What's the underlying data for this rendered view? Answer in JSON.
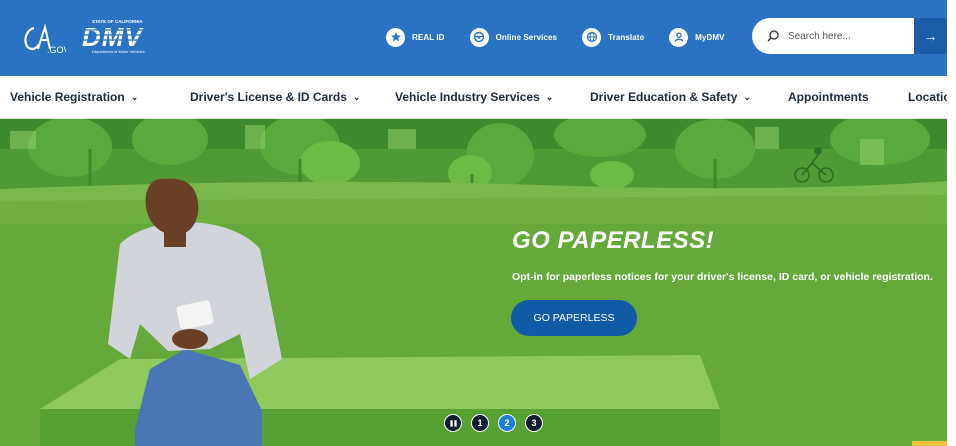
{
  "header": {
    "ca_logo_text": "CA.GOV",
    "dmv_logo_text": "DMV",
    "dmv_logo_top": "STATE OF CALIFORNIA",
    "dmv_logo_bottom": "Department of Motor Vehicles",
    "utility_links": [
      {
        "label": "REAL ID",
        "icon": "star-icon"
      },
      {
        "label": "Online Services",
        "icon": "steering-wheel-icon"
      },
      {
        "label": "Translate",
        "icon": "globe-icon"
      },
      {
        "label": "MyDMV",
        "icon": "user-icon"
      }
    ],
    "search": {
      "placeholder": "Search here...",
      "submit_icon": "→"
    }
  },
  "nav": {
    "items": [
      {
        "label": "Vehicle Registration",
        "chevron": "⌄"
      },
      {
        "label": "Driver's License & ID Cards",
        "chevron": "⌄"
      },
      {
        "label": "Vehicle Industry Services",
        "chevron": "⌄"
      },
      {
        "label": "Driver Education & Safety",
        "chevron": "⌄"
      },
      {
        "label": "Appointments",
        "chevron": ""
      },
      {
        "label": "Locations",
        "chevron": ""
      }
    ]
  },
  "hero": {
    "title": "GO PAPERLESS!",
    "subtitle": "Opt-in for paperless notices for your driver's license, ID card, or vehicle registration.",
    "cta_label": "GO PAPERLESS",
    "carousel": {
      "pause_icon": "❚❚",
      "slides": [
        "1",
        "2",
        "3"
      ],
      "active_slide": 2
    }
  },
  "colors": {
    "header_bg": "#2a73c4",
    "hero_bg": "#66a63d",
    "cta_bg": "#115aa6",
    "nav_text": "#1d2c3f"
  }
}
